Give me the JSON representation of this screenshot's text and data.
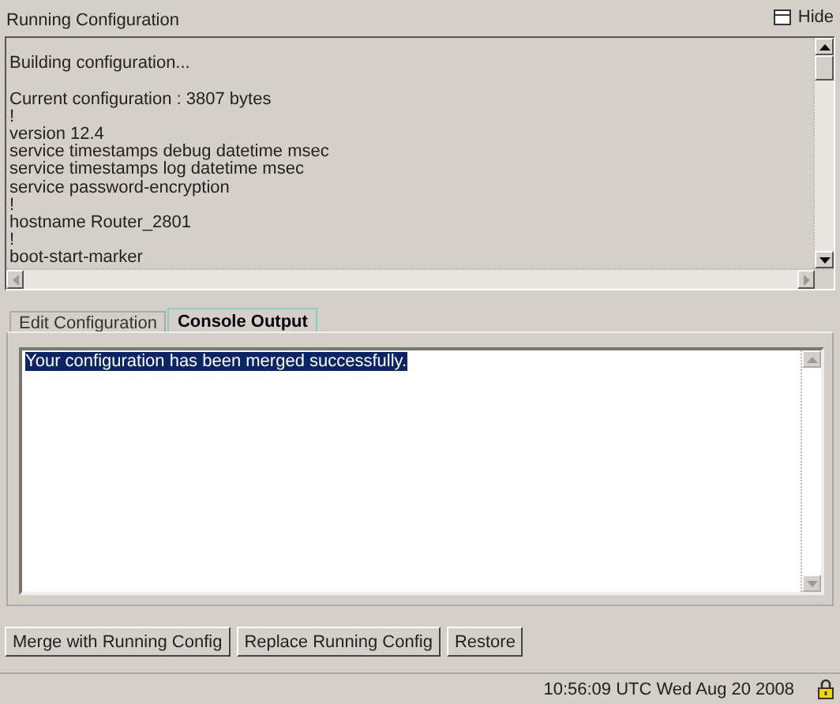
{
  "panel": {
    "title": "Running Configuration",
    "hide_button": "Hide"
  },
  "config_lines": [
    {
      "text": "Building configuration...",
      "blank_before": true
    },
    {
      "text": "Current configuration : 3807 bytes",
      "blank_before": true
    },
    {
      "text": "!",
      "blank_before": false
    },
    {
      "text": "version 12.4",
      "blank_before": false
    },
    {
      "text": "service timestamps debug datetime msec",
      "blank_before": false
    },
    {
      "text": "service timestamps log datetime msec",
      "blank_before": false
    },
    {
      "text": "service password-encryption",
      "blank_before": false
    },
    {
      "text": "!",
      "blank_before": false
    },
    {
      "text": "hostname Router_2801",
      "blank_before": false
    },
    {
      "text": "!",
      "blank_before": false
    },
    {
      "text": "boot-start-marker",
      "blank_before": false
    }
  ],
  "tabs": [
    {
      "label": "Edit Configuration",
      "selected": false
    },
    {
      "label": "Console Output",
      "selected": true
    }
  ],
  "console": {
    "text": "Your configuration has been merged successfully.",
    "highlighted": true
  },
  "buttons": [
    "Merge with Running Config",
    "Replace Running Config",
    "Restore"
  ],
  "status_bar": {
    "time": "10:56:09 UTC Wed Aug 20 2008",
    "locked": true
  }
}
